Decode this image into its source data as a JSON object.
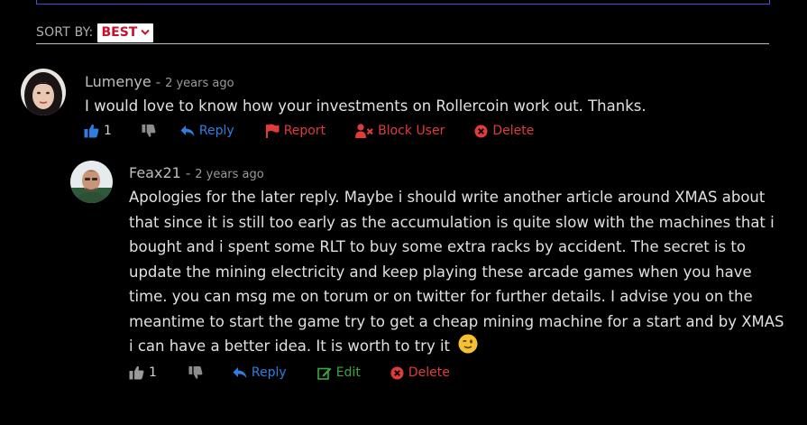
{
  "sort": {
    "label": "SORT BY:",
    "selected": "BEST"
  },
  "comments": [
    {
      "author": "Lumenye",
      "separator": "-",
      "time": "2 years ago",
      "text": "I would love to know how your investments on Rollercoin work out. Thanks.",
      "likes": "1",
      "actions": {
        "reply": "Reply",
        "report": "Report",
        "block": "Block User",
        "delete": "Delete"
      }
    },
    {
      "author": "Feax21",
      "separator": "-",
      "time": "2 years ago",
      "text_lines": [
        "Apologies for the later reply. Maybe i should write another article around XMAS about",
        "that since it is still too early as the accumulation is quite slow with the machines that i",
        "bought and i spent some RLT to buy some extra racks by accident. The secret is to",
        "update the mining electricity and keep playing these arcade games when you have",
        "time. you can msg me on torum or on twitter for further details. I advise you on the",
        "meantime to start the game try to get a cheap mining machine for a start and by XMAS",
        "i can have a better idea. It is worth to try it"
      ],
      "emoji": "winking-face",
      "likes": "1",
      "actions": {
        "reply": "Reply",
        "edit": "Edit",
        "delete": "Delete"
      }
    }
  ],
  "colors": {
    "background": "#000000",
    "accent_blue": "#2f7de1",
    "danger_red": "#e23b3b",
    "edit_green": "#3aa83a",
    "sort_red": "#c8102e"
  }
}
